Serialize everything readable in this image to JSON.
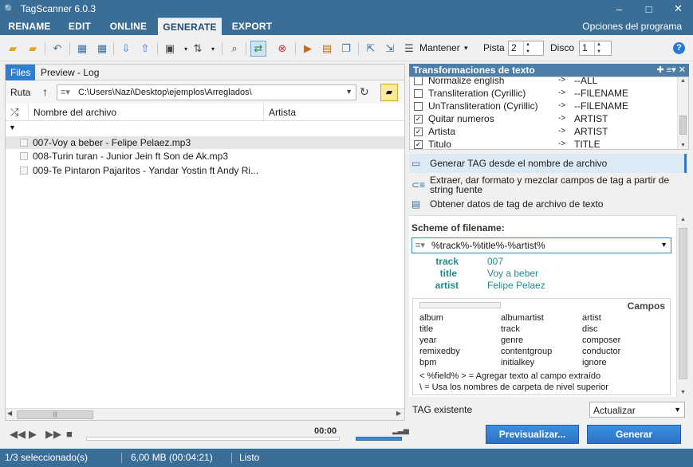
{
  "window": {
    "title": "TagScanner 6.0.3",
    "minimize": "–",
    "maximize": "□",
    "close": "✕"
  },
  "menu": {
    "tabs": [
      "RENAME",
      "EDIT",
      "ONLINE",
      "GENERATE",
      "EXPORT"
    ],
    "active": "GENERATE",
    "options": "Opciones del programa"
  },
  "toolbar": {
    "mantener_label": "Mantener",
    "pista_label": "Pista",
    "pista_value": "2",
    "disco_label": "Disco",
    "disco_value": "1",
    "help": "?"
  },
  "left": {
    "tabs": [
      "Files",
      "Preview - Log"
    ],
    "active_tab": "Files",
    "path_label": "Ruta",
    "path": "C:\\Users\\Nazi\\Desktop\\ejemplos\\Arreglados\\",
    "columns": [
      "Nombre del archivo",
      "Artista"
    ],
    "files": [
      "007-Voy a beber - Felipe Pelaez.mp3",
      "008-Turin turan - Junior Jein ft Son de Ak.mp3",
      "009-Te Pintaron Pajaritos - Yandar  Yostin ft Andy Ri..."
    ],
    "selected_index": 0
  },
  "player": {
    "time": "00:00"
  },
  "right": {
    "header": "Transformaciones de texto",
    "transformations": [
      {
        "name": "Normalize english",
        "arrow": "->",
        "value": "--ALL",
        "checked": false
      },
      {
        "name": "Transliteration (Cyrillic)",
        "arrow": "->",
        "value": "--FILENAME",
        "checked": false
      },
      {
        "name": "UnTransliteration (Cyrillic)",
        "arrow": "->",
        "value": "--FILENAME",
        "checked": false
      },
      {
        "name": "Quitar numeros",
        "arrow": "->",
        "value": "ARTIST",
        "checked": true
      },
      {
        "name": "Artista",
        "arrow": "->",
        "value": "ARTIST",
        "checked": true
      },
      {
        "name": "Titulo",
        "arrow": "->",
        "value": "TITLE",
        "checked": true
      }
    ],
    "modes": [
      "Generar TAG desde el nombre de archivo",
      "Extraer, dar formato y mezclar campos de tag a partir de string fuente",
      "Obtener datos de tag de archivo de texto"
    ],
    "active_mode": 0,
    "scheme_label": "Scheme of filename:",
    "scheme_value": "%track%-%title%-%artist%",
    "preview": [
      {
        "key": "track",
        "value": "007"
      },
      {
        "key": "title",
        "value": "Voy a beber"
      },
      {
        "key": "artist",
        "value": "Felipe Pelaez"
      }
    ],
    "campos_title": "Campos",
    "fields": [
      "album",
      "albumartist",
      "artist",
      "title",
      "track",
      "disc",
      "year",
      "genre",
      "composer",
      "remixedby",
      "contentgroup",
      "conductor",
      "bpm",
      "initialkey",
      "ignore"
    ],
    "notes": [
      "< %field% > = Agregar texto al campo extraído",
      "\\ = Usa los nombres de carpeta de nivel superior"
    ],
    "existing_tag_label": "TAG existente",
    "existing_tag_value": "Actualizar"
  },
  "buttons": {
    "preview": "Previsualizar...",
    "generate": "Generar"
  },
  "status": {
    "selected": "1/3 seleccionado(s)",
    "size": "6,00 MB (00:04:21)",
    "state": "Listo"
  },
  "colors": {
    "chrome": "#3b6e96",
    "accent": "#2f7fd1",
    "teal_text": "#1f8d8d"
  }
}
